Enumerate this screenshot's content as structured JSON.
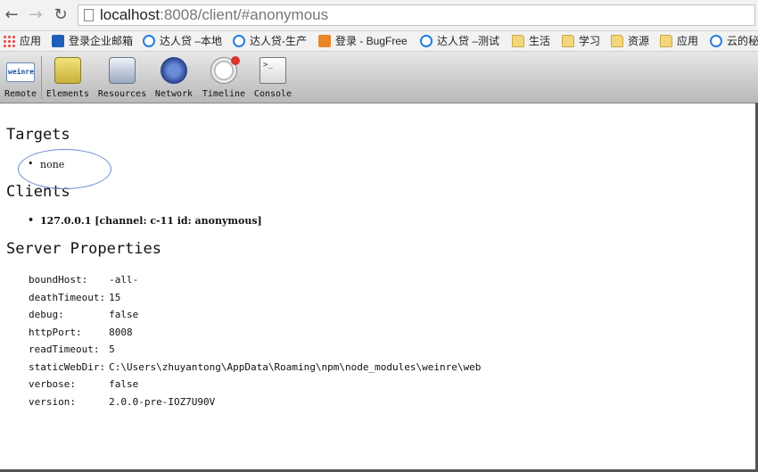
{
  "browser": {
    "url_host": "localhost",
    "url_rest": ":8008/client/#anonymous"
  },
  "bookmarks": [
    {
      "label": "应用",
      "icon": "apps-icon"
    },
    {
      "label": "登录企业邮箱",
      "icon": "mail-icon"
    },
    {
      "label": "达人贷 –本地",
      "icon": "site-icon"
    },
    {
      "label": "达人贷-生产",
      "icon": "site-icon"
    },
    {
      "label": "登录 - BugFree",
      "icon": "bugfree-icon"
    },
    {
      "label": "达人贷 –测试",
      "icon": "site-icon"
    },
    {
      "label": "生活",
      "icon": "folder-icon"
    },
    {
      "label": "学习",
      "icon": "folder-icon"
    },
    {
      "label": "资源",
      "icon": "folder-icon"
    },
    {
      "label": "应用",
      "icon": "folder-icon"
    },
    {
      "label": "云的秘",
      "icon": "cloud-icon"
    }
  ],
  "toolbar": [
    {
      "label": "Remote",
      "icon": "weinre-icon"
    },
    {
      "label": "Elements",
      "icon": "elements-icon"
    },
    {
      "label": "Resources",
      "icon": "resources-icon"
    },
    {
      "label": "Network",
      "icon": "network-icon"
    },
    {
      "label": "Timeline",
      "icon": "timeline-icon"
    },
    {
      "label": "Console",
      "icon": "console-icon"
    }
  ],
  "targets": {
    "heading": "Targets",
    "items": [
      "none"
    ]
  },
  "clients": {
    "heading": "Clients",
    "items": [
      "127.0.0.1 [channel: c-11 id: anonymous]"
    ]
  },
  "server_properties": {
    "heading": "Server Properties",
    "rows": [
      {
        "key": "boundHost:",
        "value": "-all-"
      },
      {
        "key": "deathTimeout:",
        "value": "15"
      },
      {
        "key": "debug:",
        "value": "false"
      },
      {
        "key": "httpPort:",
        "value": "8008"
      },
      {
        "key": "readTimeout:",
        "value": "5"
      },
      {
        "key": "staticWebDir:",
        "value": "C:\\Users\\zhuyantong\\AppData\\Roaming\\npm\\node_modules\\weinre\\web"
      },
      {
        "key": "verbose:",
        "value": "false"
      },
      {
        "key": "version:",
        "value": "2.0.0-pre-IOZ7U90V"
      }
    ]
  }
}
